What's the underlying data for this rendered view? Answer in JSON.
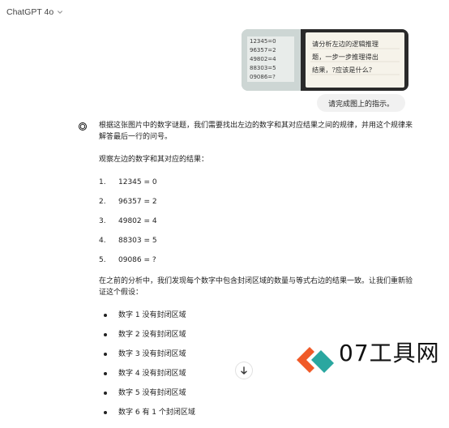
{
  "header": {
    "model_title": "ChatGPT 4o"
  },
  "user": {
    "message": "请完成图上的指示。"
  },
  "assistant": {
    "intro": "根据这张图片中的数字谜题，我们需要找出左边的数字和其对应结果之间的规律，并用这个规律来解答最后一行的问号。",
    "observe_label": "观察左边的数字和其对应的结果：",
    "equations": [
      "12345 = 0",
      "96357 = 2",
      "49802 = 4",
      "88303 = 5",
      "09086 = ?"
    ],
    "analysis": "在之前的分析中，我们发现每个数字中包含封闭区域的数量与等式右边的结果一致。让我们重新验证这个假设：",
    "bullets": [
      "数字 1 没有封闭区域",
      "数字 2 没有封闭区域",
      "数字 3 没有封闭区域",
      "数字 4 没有封闭区域",
      "数字 5 没有封闭区域",
      "数字 6 有 1 个封闭区域"
    ]
  },
  "attachment": {
    "photo_equations": [
      "12345=0",
      "96357=2",
      "49802=4",
      "88303=5",
      "09086=?"
    ],
    "note_lines": [
      "请分析左边的逻辑推理",
      "题，一步一步推理得出",
      "结果，?应该是什么？"
    ]
  },
  "watermark": {
    "text": "07工具网"
  },
  "colors": {
    "watermark_orange": "#f05a28",
    "watermark_teal": "#2aa7a0"
  },
  "icons": {
    "chevron": "chevron-down-icon",
    "assistant": "openai-logo-icon",
    "scroll": "arrow-down-icon"
  }
}
